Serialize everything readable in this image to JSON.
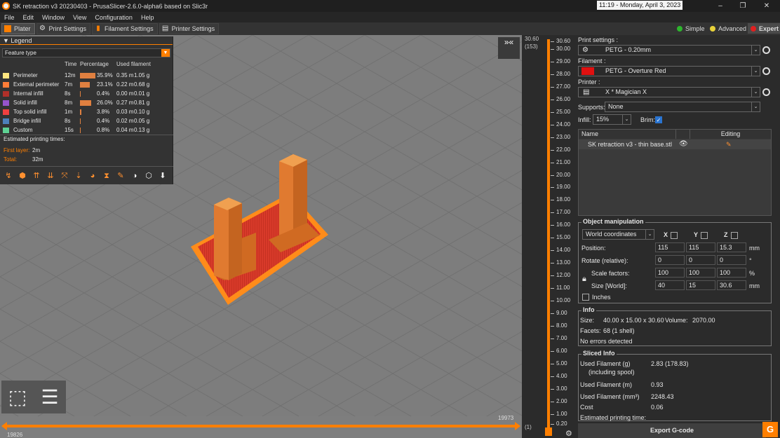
{
  "titlebar": {
    "title": "SK retraction v3 20230403 - PrusaSlicer-2.6.0-alpha6 based on Slic3r",
    "clock": "11:19 - Monday, April 3, 2023",
    "minimize": "–",
    "maximize": "❐",
    "close": "✕"
  },
  "menu": [
    "File",
    "Edit",
    "Window",
    "View",
    "Configuration",
    "Help"
  ],
  "tabs": [
    {
      "label": "Plater",
      "icon": "plater-icon"
    },
    {
      "label": "Print Settings",
      "icon": "print-settings-icon"
    },
    {
      "label": "Filament Settings",
      "icon": "filament-icon"
    },
    {
      "label": "Printer Settings",
      "icon": "printer-icon"
    }
  ],
  "modes": [
    {
      "label": "Simple",
      "color": "#2db52d"
    },
    {
      "label": "Advanced",
      "color": "#e8d23a"
    },
    {
      "label": "Expert",
      "color": "#e02020"
    }
  ],
  "legend": {
    "title": "Legend",
    "select": "Feature type",
    "headers": {
      "time": "Time",
      "percentage": "Percentage",
      "filament": "Used filament"
    },
    "rows": [
      {
        "name": "Perimeter",
        "color": "#ffe680",
        "time": "12m",
        "pct": "35.9%",
        "m": "0.35 m",
        "g": "1.05 g",
        "frac": 0.359
      },
      {
        "name": "External perimeter",
        "color": "#ff7d38",
        "time": "7m",
        "pct": "23.1%",
        "m": "0.22 m",
        "g": "0.68 g",
        "frac": 0.231
      },
      {
        "name": "Internal infill",
        "color": "#b03029",
        "time": "8s",
        "pct": "0.4%",
        "m": "0.00 m",
        "g": "0.01 g",
        "frac": 0.004
      },
      {
        "name": "Solid infill",
        "color": "#9654cc",
        "time": "8m",
        "pct": "26.0%",
        "m": "0.27 m",
        "g": "0.81 g",
        "frac": 0.26
      },
      {
        "name": "Top solid infill",
        "color": "#f04040",
        "time": "1m",
        "pct": "3.8%",
        "m": "0.03 m",
        "g": "0.10 g",
        "frac": 0.038
      },
      {
        "name": "Bridge infill",
        "color": "#4d80ba",
        "time": "8s",
        "pct": "0.4%",
        "m": "0.02 m",
        "g": "0.05 g",
        "frac": 0.004
      },
      {
        "name": "Custom",
        "color": "#5ed194",
        "time": "15s",
        "pct": "0.8%",
        "m": "0.04 m",
        "g": "0.13 g",
        "frac": 0.008
      }
    ],
    "est_title": "Estimated printing times:",
    "first_layer_label": "First layer:",
    "first_layer": "2m",
    "total_label": "Total:",
    "total": "32m"
  },
  "collapse_label": "»«",
  "hslider": {
    "left_value": "19826",
    "right_value": "19973"
  },
  "vslider": {
    "top_value": "30.60",
    "top_layer": "(153)",
    "bottom_value": "0.20",
    "bottom_layer": "(1)",
    "ticks": [
      "30.60",
      "30.00",
      "29.00",
      "28.00",
      "27.00",
      "26.00",
      "25.00",
      "24.00",
      "23.00",
      "22.00",
      "21.00",
      "20.00",
      "19.00",
      "18.00",
      "17.00",
      "16.00",
      "15.00",
      "14.00",
      "13.00",
      "12.00",
      "11.00",
      "10.00",
      "9.00",
      "8.00",
      "7.00",
      "6.00",
      "5.00",
      "4.00",
      "3.00",
      "2.00",
      "1.00",
      "0.20"
    ]
  },
  "sidebar": {
    "print_settings_label": "Print settings :",
    "print_settings_value": "PETG - 0.20mm",
    "filament_label": "Filament :",
    "filament_value": "PETG - Overture Red",
    "filament_color": "#e01010",
    "printer_label": "Printer :",
    "printer_value": "X * Magician X",
    "supports_label": "Supports:",
    "supports_value": "None",
    "infill_label": "Infill:",
    "infill_value": "15%",
    "brim_label": "Brim:",
    "object_list": {
      "col_name": "Name",
      "col_editing": "Editing",
      "object": "SK retraction v3 - thin base.stl"
    },
    "manip": {
      "title": "Object manipulation",
      "coords": "World coordinates",
      "axes": [
        "X",
        "Y",
        "Z"
      ],
      "position_label": "Position:",
      "position": [
        "115",
        "115",
        "15.3"
      ],
      "position_unit": "mm",
      "rotate_label": "Rotate (relative):",
      "rotate": [
        "0",
        "0",
        "0"
      ],
      "rotate_unit": "°",
      "scale_label": "Scale factors:",
      "scale": [
        "100",
        "100",
        "100"
      ],
      "scale_unit": "%",
      "size_label": "Size [World]:",
      "size": [
        "40",
        "15",
        "30.6"
      ],
      "size_unit": "mm",
      "inches_label": "Inches"
    },
    "info": {
      "title": "Info",
      "size_label": "Size:",
      "size_value": "40.00 x 15.00 x 30.60",
      "volume_label": "Volume:",
      "volume_value": "2070.00",
      "facets_label": "Facets:",
      "facets_value": "68 (1 shell)",
      "errors": "No errors detected"
    },
    "sliced": {
      "title": "Sliced Info",
      "used_g_label": "Used Filament (g)",
      "used_g_sub": "(including spool)",
      "used_g_value": "2.83 (178.83)",
      "used_m_label": "Used Filament (m)",
      "used_m_value": "0.93",
      "used_mm3_label": "Used Filament (mm³)",
      "used_mm3_value": "2248.43",
      "cost_label": "Cost",
      "cost_value": "0.06",
      "est_label": "Estimated printing time:"
    },
    "export_label": "Export G-code",
    "g_label": "G"
  }
}
